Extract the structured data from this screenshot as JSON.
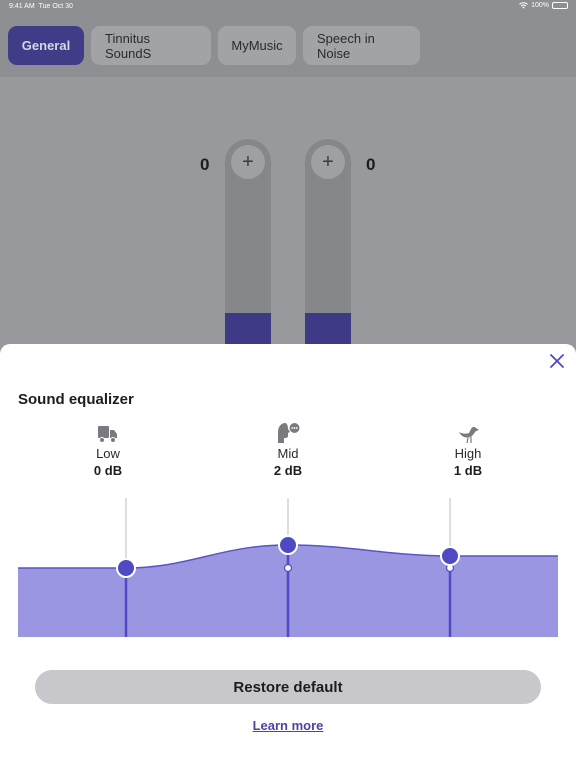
{
  "status_bar": {
    "time": "9:41 AM",
    "date": "Tue Oct 30",
    "battery": "100%"
  },
  "tabs": [
    {
      "label": "General",
      "active": true
    },
    {
      "label": "Tinnitus SoundS",
      "active": false
    },
    {
      "label": "MyMusic",
      "active": false
    },
    {
      "label": "Speech in Noise",
      "active": false
    }
  ],
  "volume": {
    "left_value": "0",
    "right_value": "0",
    "plus_label": "+",
    "left_level": 0.21,
    "right_level": 0.21
  },
  "equalizer": {
    "title": "Sound equalizer",
    "bands": [
      {
        "icon": "truck-icon",
        "label": "Low",
        "value": "0 dB",
        "db": 0
      },
      {
        "icon": "speaking-head-icon",
        "label": "Mid",
        "value": "2 dB",
        "db": 2
      },
      {
        "icon": "bird-icon",
        "label": "High",
        "value": "1 dB",
        "db": 1
      }
    ],
    "restore_label": "Restore default",
    "learn_more_label": "Learn more"
  },
  "colors": {
    "accent": "#4f49c4",
    "curve_fill": "#9b96e1",
    "active_tab": "#403c88",
    "volume_fill": "#3e3a86"
  }
}
